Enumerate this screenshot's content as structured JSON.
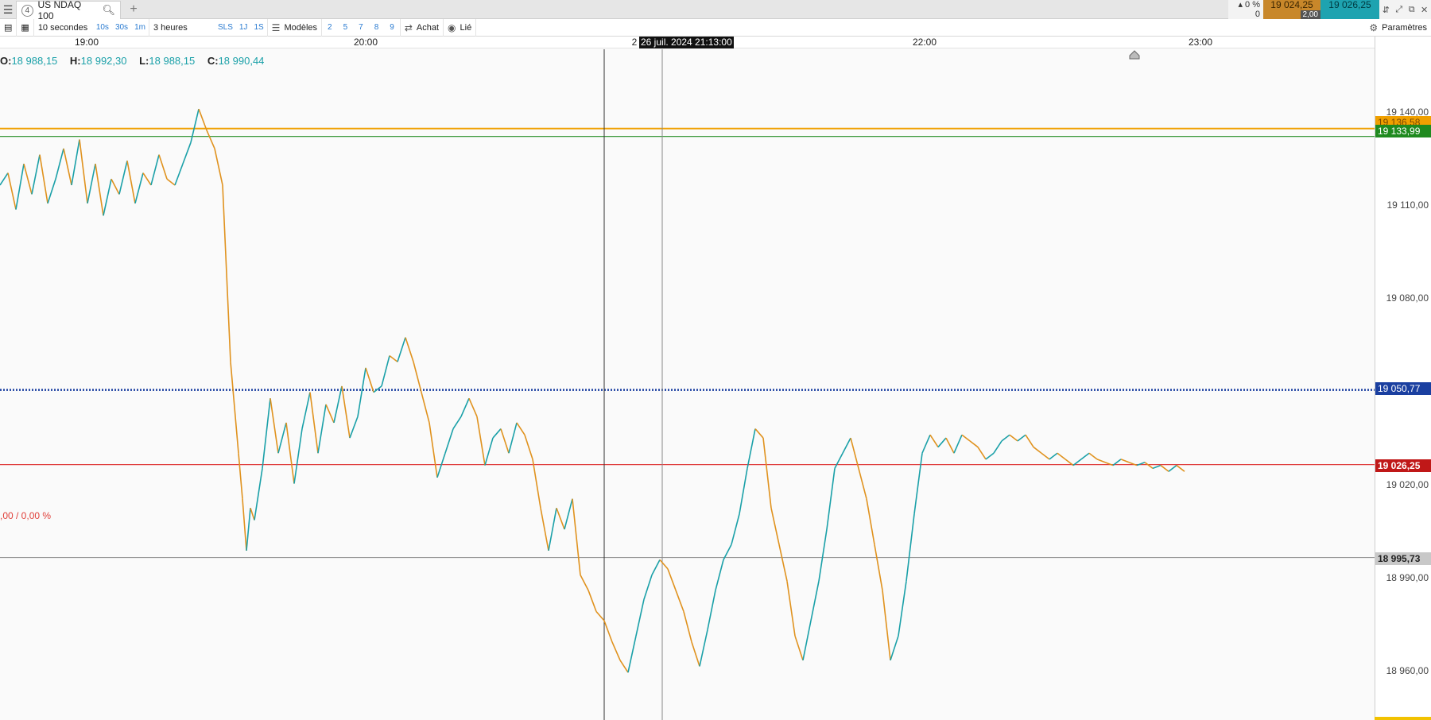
{
  "tabbar": {
    "tab_number": "4",
    "tab_title": "US NDAQ 100",
    "add_tab": "+",
    "menu_icon": "hamburger-icon",
    "search_icon": "search-icon"
  },
  "quote": {
    "change_pct": "0 %",
    "change_abs": "0",
    "bid": "19 024,25",
    "spread": "2,00",
    "ask": "19 026,25",
    "bid_color": "#c8872a",
    "ask_color": "#1ea3b0"
  },
  "toolbar": {
    "interval": "10 secondes",
    "btn_10s": "10s",
    "btn_30s": "30s",
    "btn_1m": "1m",
    "period": "3 heures",
    "btn_sls": "SLS",
    "btn_1j": "1J",
    "btn_1s": "1S",
    "templates": "Modèles",
    "n2": "2",
    "n5": "5",
    "n7": "7",
    "n8": "8",
    "n9": "9",
    "buy": "Achat",
    "linked": "Lié",
    "settings": "Paramètres"
  },
  "timeaxis": {
    "labels": [
      "19:00",
      "20:00",
      "22:00",
      "23:00"
    ],
    "partial_label": "2",
    "crosshair_date": "26 juil. 2024 21:13:00"
  },
  "ohlc": {
    "o_label": "O:",
    "o": "18 988,15",
    "h_label": "H:",
    "h": "18 992,30",
    "l_label": "L:",
    "l": "18 988,15",
    "c_label": "C:",
    "c": "18 990,44"
  },
  "pct_label": ",00 / 0,00 %",
  "price_axis": {
    "ticks": [
      "19 140,00",
      "19 110,00",
      "19 080,00",
      "19 020,00",
      "18 990,00",
      "18 960,00"
    ],
    "badge_orange": "19 136,58",
    "badge_green": "19 133,99",
    "badge_blue": "19 050,77",
    "badge_red": "19 026,25",
    "badge_grey": "18 995,73"
  },
  "colors": {
    "up": "#1aa0a8",
    "down": "#e0921e",
    "orange_line": "#f0a000",
    "green_line": "#1f8a1f",
    "blue_line": "#1a3fa0",
    "red_line": "#e04040"
  },
  "chart_data": {
    "type": "line",
    "series": [
      {
        "name": "",
        "points": [
          [
            0,
            19118
          ],
          [
            10,
            19122
          ],
          [
            20,
            19110
          ],
          [
            30,
            19125
          ],
          [
            40,
            19115
          ],
          [
            50,
            19128
          ],
          [
            60,
            19112
          ],
          [
            70,
            19120
          ],
          [
            80,
            19130
          ],
          [
            90,
            19118
          ],
          [
            100,
            19133
          ],
          [
            110,
            19112
          ],
          [
            120,
            19125
          ],
          [
            130,
            19108
          ],
          [
            140,
            19120
          ],
          [
            150,
            19115
          ],
          [
            160,
            19126
          ],
          [
            170,
            19112
          ],
          [
            180,
            19122
          ],
          [
            190,
            19118
          ],
          [
            200,
            19128
          ],
          [
            210,
            19120
          ],
          [
            220,
            19118
          ],
          [
            230,
            19125
          ],
          [
            240,
            19132
          ],
          [
            250,
            19143
          ],
          [
            260,
            19136
          ],
          [
            270,
            19130
          ],
          [
            280,
            19118
          ],
          [
            290,
            19060
          ],
          [
            300,
            19030
          ],
          [
            305,
            19015
          ],
          [
            310,
            18998
          ],
          [
            315,
            19012
          ],
          [
            320,
            19008
          ],
          [
            330,
            19025
          ],
          [
            340,
            19048
          ],
          [
            350,
            19030
          ],
          [
            360,
            19040
          ],
          [
            370,
            19020
          ],
          [
            380,
            19038
          ],
          [
            390,
            19050
          ],
          [
            400,
            19030
          ],
          [
            410,
            19046
          ],
          [
            420,
            19040
          ],
          [
            430,
            19052
          ],
          [
            440,
            19035
          ],
          [
            450,
            19042
          ],
          [
            460,
            19058
          ],
          [
            470,
            19050
          ],
          [
            480,
            19052
          ],
          [
            490,
            19062
          ],
          [
            500,
            19060
          ],
          [
            510,
            19068
          ],
          [
            520,
            19060
          ],
          [
            530,
            19050
          ],
          [
            540,
            19040
          ],
          [
            550,
            19022
          ],
          [
            560,
            19030
          ],
          [
            570,
            19038
          ],
          [
            580,
            19042
          ],
          [
            590,
            19048
          ],
          [
            600,
            19042
          ],
          [
            610,
            19026
          ],
          [
            620,
            19035
          ],
          [
            630,
            19038
          ],
          [
            640,
            19030
          ],
          [
            650,
            19040
          ],
          [
            660,
            19036
          ],
          [
            670,
            19028
          ],
          [
            680,
            19012
          ],
          [
            690,
            18998
          ],
          [
            700,
            19012
          ],
          [
            710,
            19005
          ],
          [
            720,
            19015
          ],
          [
            730,
            18990
          ],
          [
            740,
            18985
          ],
          [
            750,
            18978
          ],
          [
            760,
            18975
          ],
          [
            770,
            18968
          ],
          [
            780,
            18962
          ],
          [
            790,
            18958
          ],
          [
            800,
            18970
          ],
          [
            810,
            18982
          ],
          [
            820,
            18990
          ],
          [
            830,
            18995
          ],
          [
            840,
            18992
          ],
          [
            850,
            18985
          ],
          [
            860,
            18978
          ],
          [
            870,
            18968
          ],
          [
            880,
            18960
          ],
          [
            890,
            18972
          ],
          [
            900,
            18985
          ],
          [
            910,
            18995
          ],
          [
            920,
            19000
          ],
          [
            930,
            19010
          ],
          [
            940,
            19025
          ],
          [
            950,
            19038
          ],
          [
            960,
            19035
          ],
          [
            970,
            19012
          ],
          [
            980,
            19000
          ],
          [
            990,
            18988
          ],
          [
            1000,
            18970
          ],
          [
            1010,
            18962
          ],
          [
            1020,
            18975
          ],
          [
            1030,
            18988
          ],
          [
            1040,
            19005
          ],
          [
            1050,
            19025
          ],
          [
            1060,
            19030
          ],
          [
            1070,
            19035
          ],
          [
            1080,
            19025
          ],
          [
            1090,
            19015
          ],
          [
            1100,
            19000
          ],
          [
            1110,
            18985
          ],
          [
            1120,
            18962
          ],
          [
            1130,
            18970
          ],
          [
            1140,
            18988
          ],
          [
            1150,
            19010
          ],
          [
            1160,
            19030
          ],
          [
            1170,
            19036
          ],
          [
            1180,
            19032
          ],
          [
            1190,
            19035
          ],
          [
            1200,
            19030
          ],
          [
            1210,
            19036
          ],
          [
            1220,
            19034
          ],
          [
            1230,
            19032
          ],
          [
            1240,
            19028
          ],
          [
            1250,
            19030
          ],
          [
            1260,
            19034
          ],
          [
            1270,
            19036
          ],
          [
            1280,
            19034
          ],
          [
            1290,
            19036
          ],
          [
            1300,
            19032
          ],
          [
            1310,
            19030
          ],
          [
            1320,
            19028
          ],
          [
            1330,
            19030
          ],
          [
            1340,
            19028
          ],
          [
            1350,
            19026
          ],
          [
            1360,
            19028
          ],
          [
            1370,
            19030
          ],
          [
            1380,
            19028
          ],
          [
            1390,
            19027
          ],
          [
            1400,
            19026
          ],
          [
            1410,
            19028
          ],
          [
            1420,
            19027
          ],
          [
            1430,
            19026
          ],
          [
            1440,
            19027
          ],
          [
            1450,
            19025
          ],
          [
            1460,
            19026
          ],
          [
            1470,
            19024
          ],
          [
            1480,
            19026
          ],
          [
            1490,
            19024
          ]
        ]
      }
    ],
    "ylim": [
      18945,
      19160
    ],
    "horizontal_lines": [
      {
        "value": 19136.58,
        "color": "#f0a000",
        "style": "solid"
      },
      {
        "value": 19133.99,
        "color": "#1f8a1f",
        "style": "solid"
      },
      {
        "value": 19050.77,
        "color": "#1a3fa0",
        "style": "dotted"
      },
      {
        "value": 19026.25,
        "color": "#e04040",
        "style": "solid"
      },
      {
        "value": 18995.73,
        "color": "#999999",
        "style": "solid"
      }
    ]
  }
}
